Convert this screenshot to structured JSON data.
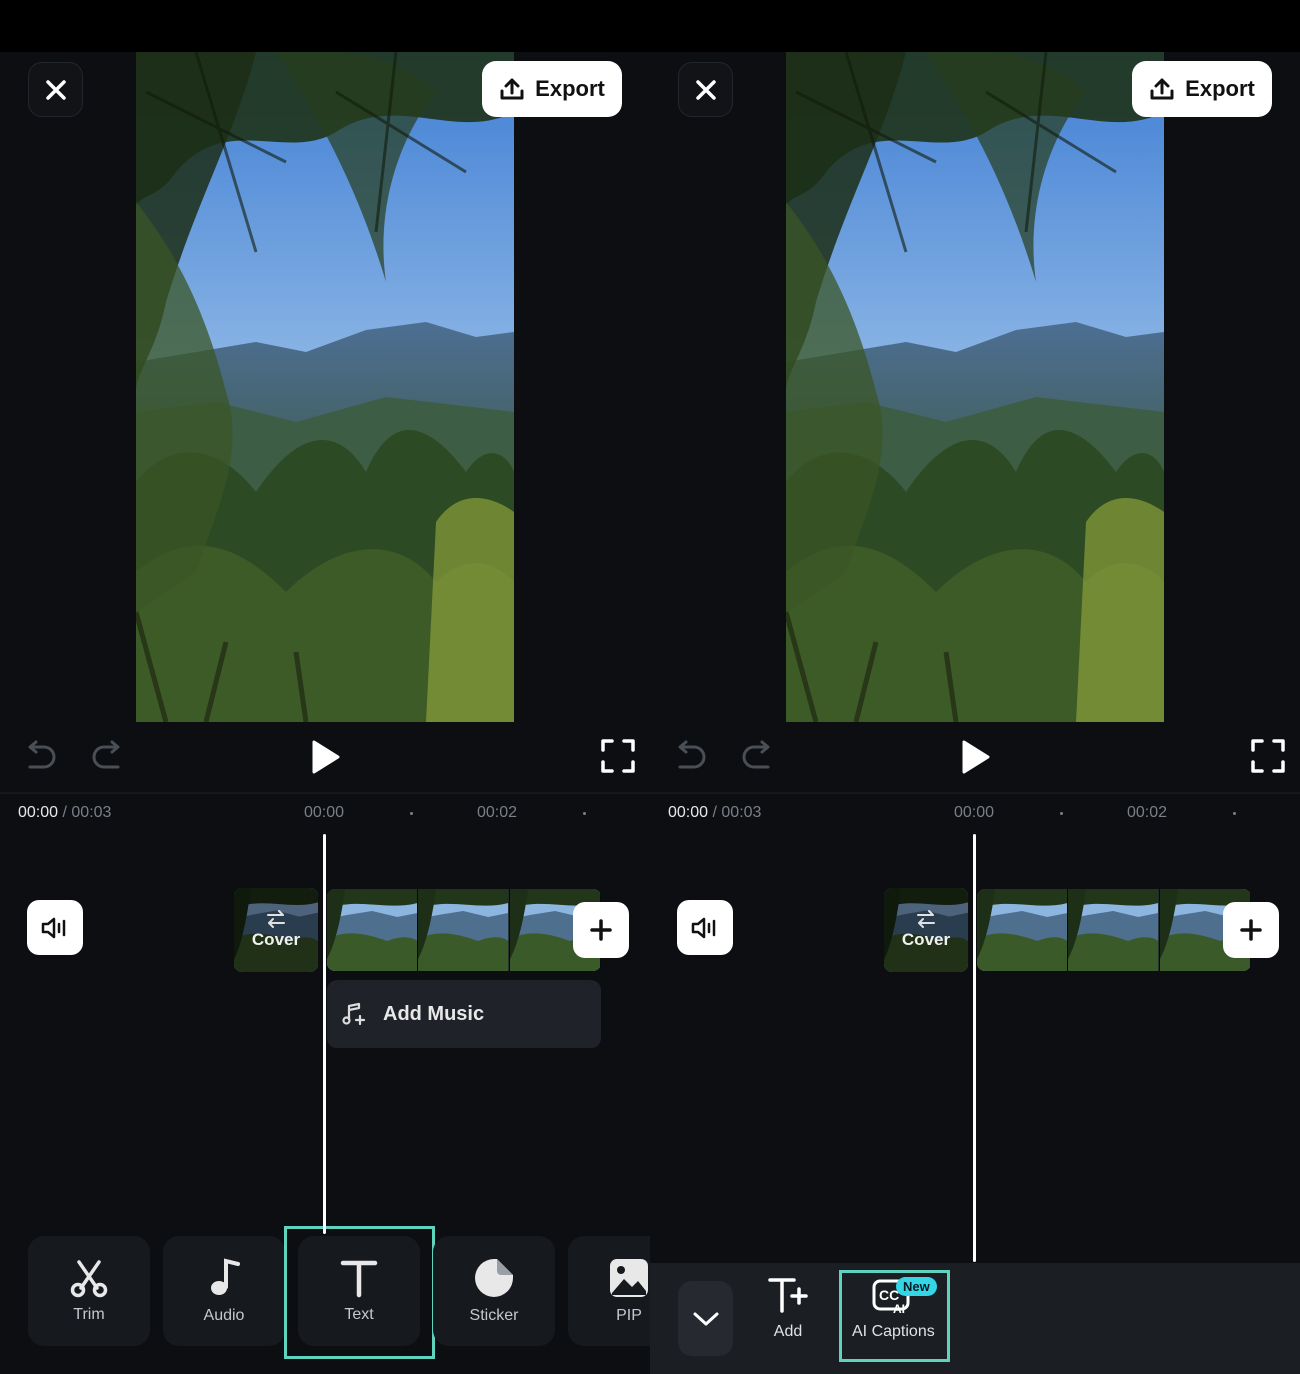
{
  "colors": {
    "accent_highlight": "#5fd3bd",
    "new_badge": "#34d6e6",
    "background": "#0c0e12"
  },
  "panels": [
    {
      "id": "left",
      "export_label": "Export",
      "time": {
        "current": "00:00",
        "separator": "/",
        "total": "00:03"
      },
      "ruler": [
        "00:00",
        "00:02"
      ],
      "cover_label": "Cover",
      "add_music_label": "Add Music",
      "toolbar": [
        {
          "label": "Trim",
          "icon": "scissors-icon"
        },
        {
          "label": "Audio",
          "icon": "music-note-icon"
        },
        {
          "label": "Text",
          "icon": "text-icon",
          "highlighted": true
        },
        {
          "label": "Sticker",
          "icon": "sticker-icon"
        },
        {
          "label": "PIP",
          "icon": "image-icon"
        }
      ]
    },
    {
      "id": "right",
      "export_label": "Export",
      "time": {
        "current": "00:00",
        "separator": "/",
        "total": "00:03"
      },
      "ruler": [
        "00:00",
        "00:02"
      ],
      "cover_label": "Cover",
      "text_tools": [
        {
          "label": "Add",
          "icon": "text-add-icon"
        },
        {
          "label": "AI Captions",
          "icon": "ai-captions-icon",
          "badge": "New",
          "highlighted": true
        }
      ]
    }
  ]
}
